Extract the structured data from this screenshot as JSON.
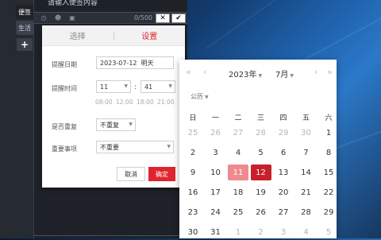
{
  "app": {
    "side_tabs": [
      "便签",
      "生活"
    ],
    "add_label": "+",
    "note_text": "请输入便签内容",
    "counter": "0/500",
    "close_label": "✕",
    "confirm_label": "✔"
  },
  "dialog": {
    "tabs": [
      "选择",
      "设置"
    ],
    "date_label": "提醒日期",
    "date_value": "2023-07-12",
    "date_hint": "明天",
    "time_label": "提醒时间",
    "hour": "11",
    "minute": "41",
    "time_sep": ":",
    "quick_times": [
      "08:00",
      "12:00",
      "18:00",
      "21:00"
    ],
    "repeat_label": "是否重复",
    "repeat_value": "不重复",
    "importance_label": "重要事项",
    "importance_value": "不重要",
    "cancel_label": "取消",
    "ok_label": "确定"
  },
  "calendar": {
    "year_label": "2023年",
    "month_label": "7月",
    "mode_label": "公历",
    "weekdays": [
      "日",
      "一",
      "二",
      "三",
      "四",
      "五",
      "六"
    ],
    "weeks": [
      [
        "25",
        "26",
        "27",
        "28",
        "29",
        "30",
        "1"
      ],
      [
        "2",
        "3",
        "4",
        "5",
        "6",
        "7",
        "8"
      ],
      [
        "9",
        "10",
        "11",
        "12",
        "13",
        "14",
        "15"
      ],
      [
        "16",
        "17",
        "18",
        "19",
        "20",
        "21",
        "22"
      ],
      [
        "23",
        "24",
        "25",
        "26",
        "27",
        "28",
        "29"
      ],
      [
        "30",
        "31",
        "1",
        "2",
        "3",
        "4",
        "5"
      ]
    ],
    "today": "11",
    "selected": "12",
    "colors": {
      "accent": "#c8202a",
      "today": "#ef8a8e",
      "ok_button": "#e0242f"
    }
  }
}
